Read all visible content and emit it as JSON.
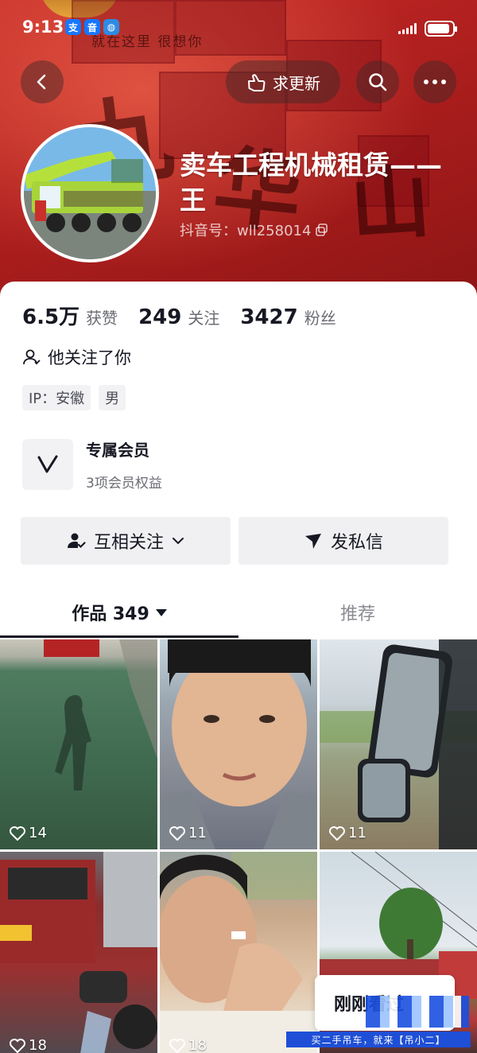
{
  "status_bar": {
    "time": "9:13",
    "app_badges": [
      "支",
      "音",
      "◍"
    ]
  },
  "header": {
    "banner_text": "就在这里 很想你",
    "request_update_label": "求更新",
    "icons": {
      "back": "back-arrow-icon",
      "search": "search-icon",
      "more": "more-dots-icon"
    }
  },
  "profile": {
    "nickname": "卖车工程机械租赁——王",
    "douyin_id": "抖音号：wll258014",
    "stats": [
      {
        "value": "6.5万",
        "label": "获赞"
      },
      {
        "value": "249",
        "label": "关注"
      },
      {
        "value": "3427",
        "label": "粉丝"
      }
    ],
    "follow_tip": "他关注了你",
    "tags": [
      "IP：安徽",
      "男"
    ],
    "member": {
      "title": "专属会员",
      "subtitle": "3项会员权益"
    }
  },
  "actions": {
    "mutual_follow": "互相关注",
    "message": "发私信"
  },
  "tabs": [
    {
      "label": "作品 349",
      "active": true
    },
    {
      "label": "推荐",
      "active": false
    }
  ],
  "videos": [
    {
      "likes": "14"
    },
    {
      "likes": "11"
    },
    {
      "likes": "11"
    },
    {
      "likes": "18"
    },
    {
      "likes": "18"
    },
    {
      "likes": ""
    }
  ],
  "overlay": {
    "recent_viewed": "刚刚看过",
    "watermark": "买二手吊车，就来【吊小二】"
  },
  "colors": {
    "banner_red": "#b1201f",
    "text_primary": "#161823",
    "text_secondary": "#6b6c73",
    "button_bg": "#f0f0f2"
  }
}
